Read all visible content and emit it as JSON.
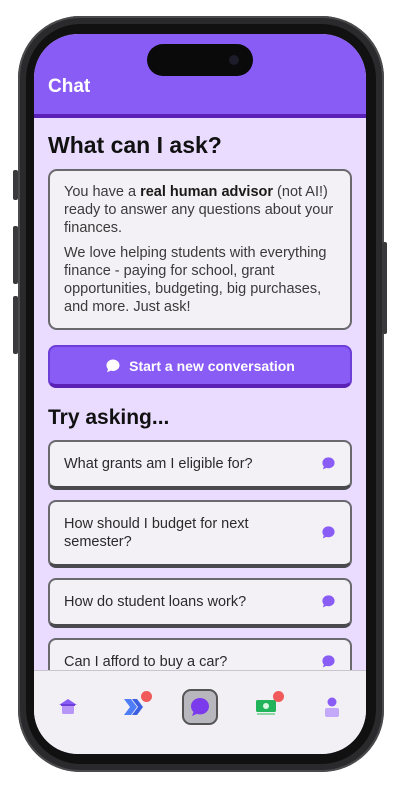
{
  "header": {
    "title": "Chat"
  },
  "intro": {
    "heading": "What can I ask?",
    "p1_before": "You have a ",
    "p1_bold": "real human advisor",
    "p1_after": " (not AI!) ready to answer any questions about your finances.",
    "p2": "We love helping students with everything finance - paying for school, grant opportunities, budgeting, big purchases, and more. Just ask!"
  },
  "start_button": {
    "label": "Start a new conversation"
  },
  "suggestions": {
    "heading": "Try asking...",
    "items": [
      {
        "label": "What grants am I eligible for?"
      },
      {
        "label": "How should I budget for next semester?"
      },
      {
        "label": "How do student loans work?"
      },
      {
        "label": "Can I afford to buy a car?"
      }
    ]
  },
  "tabs": [
    {
      "icon": "home-icon",
      "badge": false
    },
    {
      "icon": "chevrons-icon",
      "badge": true
    },
    {
      "icon": "chat-icon",
      "badge": false,
      "active": true
    },
    {
      "icon": "money-icon",
      "badge": true
    },
    {
      "icon": "profile-icon",
      "badge": false
    }
  ],
  "colors": {
    "accent": "#8a5cf6",
    "accent_dark": "#5b21b6",
    "background": "#e9dcff",
    "badge": "#f05a5a"
  }
}
